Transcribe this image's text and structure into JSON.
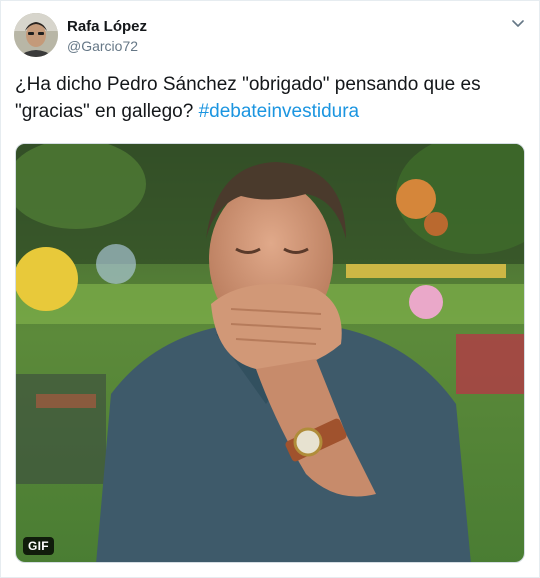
{
  "tweet": {
    "author_name": "Rafa López",
    "author_handle": "@Garcio72",
    "text_plain": "¿Ha dicho Pedro Sánchez \"obrigado\" pensando que es \"gracias\" en gallego? ",
    "hashtag": "#debateinvestidura",
    "media_badge": "GIF"
  },
  "icons": {
    "menu": "chevron-down-icon",
    "avatar": "avatar"
  },
  "colors": {
    "hashtag": "#1b95e0",
    "name": "#14171a",
    "handle": "#657786",
    "border": "#e6ecf0"
  }
}
